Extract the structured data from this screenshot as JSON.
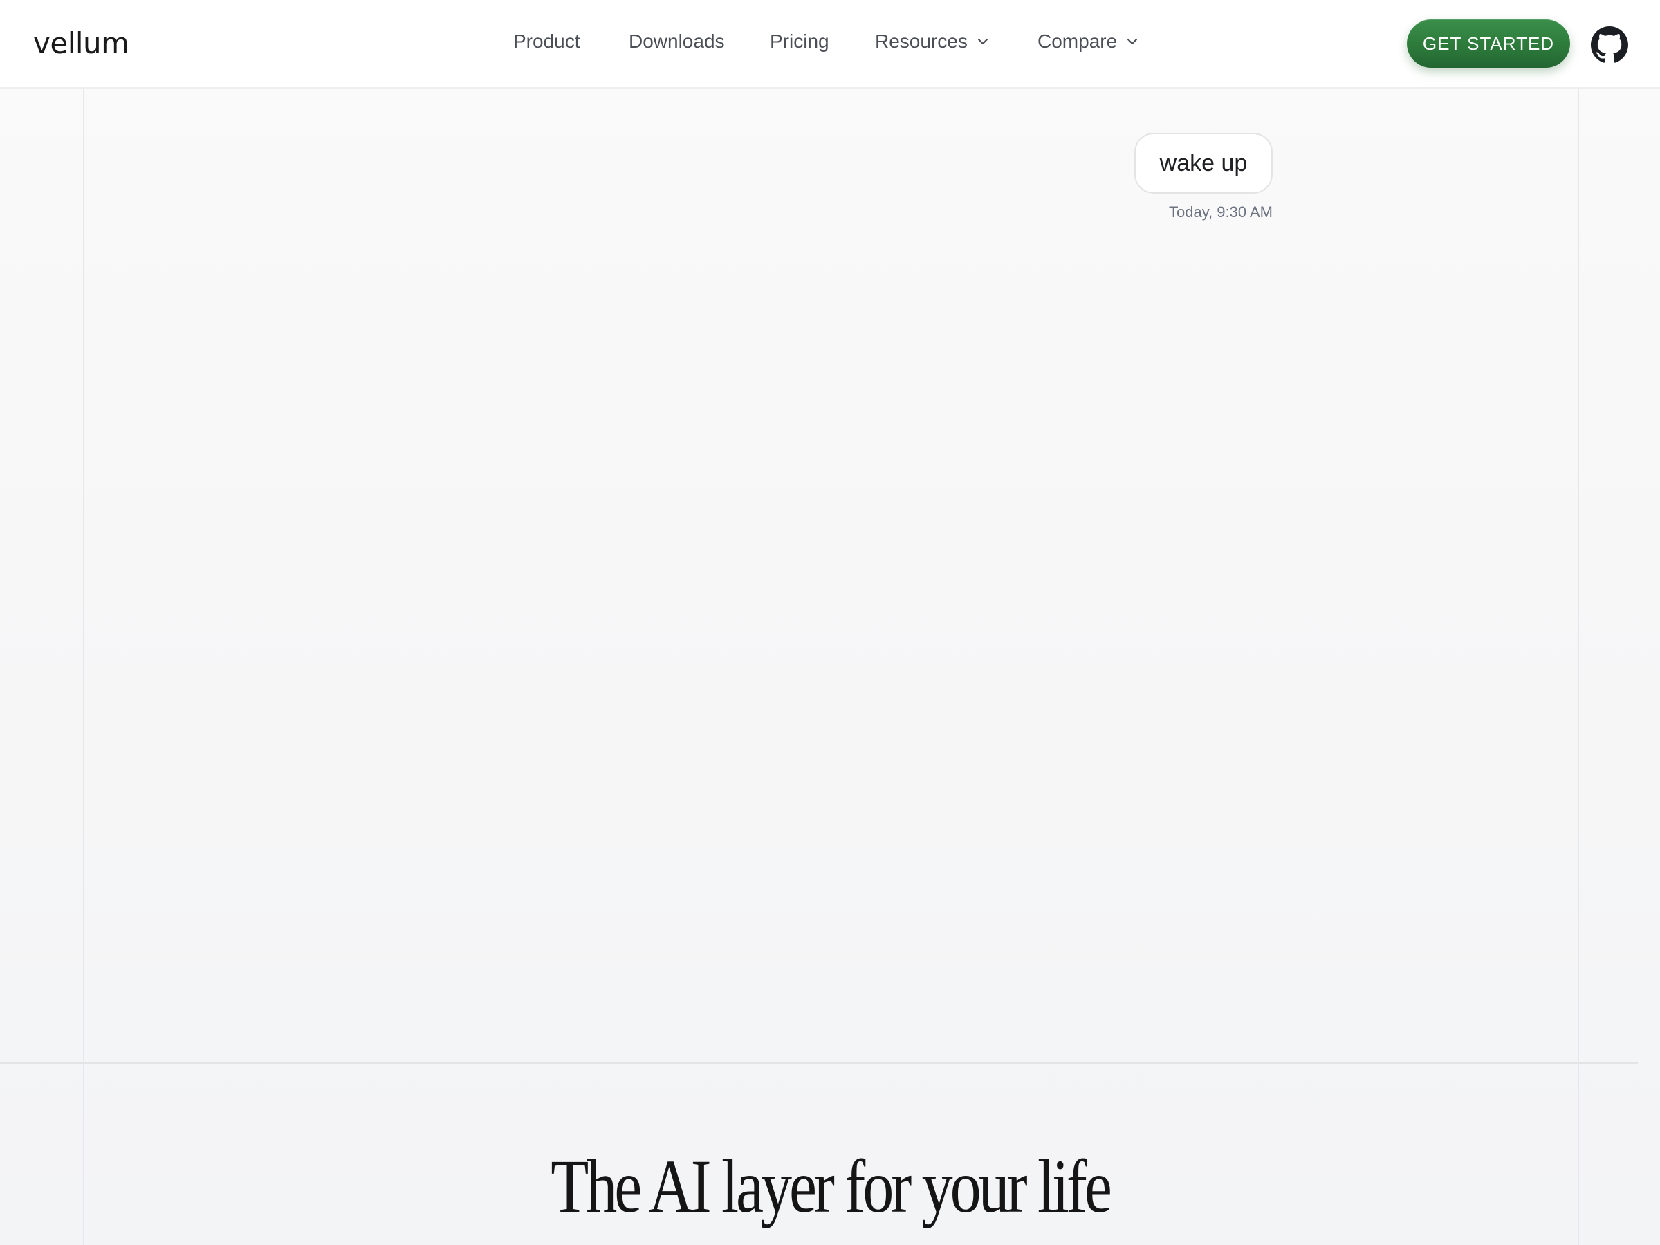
{
  "header": {
    "logo": "vellum",
    "nav": [
      {
        "label": "Product",
        "has_dropdown": false
      },
      {
        "label": "Downloads",
        "has_dropdown": false
      },
      {
        "label": "Pricing",
        "has_dropdown": false
      },
      {
        "label": "Resources",
        "has_dropdown": true
      },
      {
        "label": "Compare",
        "has_dropdown": true
      }
    ],
    "cta_label": "GET STARTED",
    "github_icon": "github-icon"
  },
  "chat": {
    "message": "wake up",
    "timestamp": "Today, 9:30 AM"
  },
  "hero": {
    "title": "The AI layer for your life"
  },
  "colors": {
    "accent": "#2d7a3b",
    "background": "#f7f7f8",
    "text": "#1f2937",
    "muted": "#6b7280"
  }
}
